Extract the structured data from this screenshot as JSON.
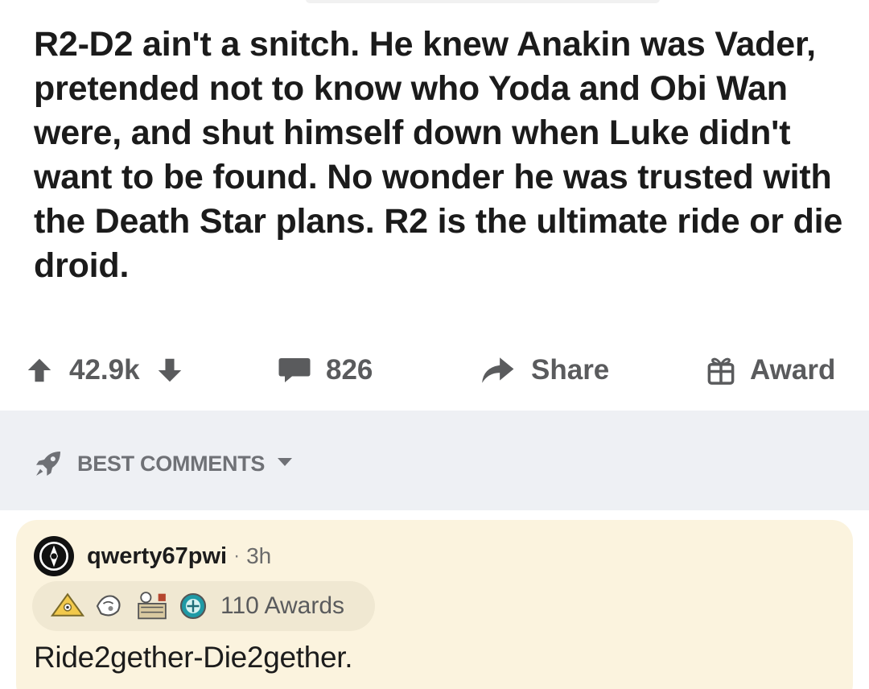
{
  "post": {
    "text": "R2-D2 ain't a snitch. He knew Anakin was Vader, pretended not to know who Yoda and Obi Wan were, and shut himself down when Luke didn't want to be found. No wonder he was trusted with the Death Star plans. R2 is the ultimate ride or die droid."
  },
  "actions": {
    "score": "42.9k",
    "comments": "826",
    "share_label": "Share",
    "award_label": "Award"
  },
  "sort": {
    "label": "BEST COMMENTS"
  },
  "comment": {
    "username": "qwerty67pwi",
    "separator": "·",
    "time": "3h",
    "awards_count": "110 Awards",
    "text": "Ride2gether-Die2gether."
  },
  "icons": [
    "upvote-icon",
    "downvote-icon",
    "comment-icon",
    "share-arrow-icon",
    "gift-icon",
    "rocket-icon",
    "caret-down-icon",
    "avatar-icon",
    "award-icons"
  ],
  "colors": {
    "text": "#1b1b1b",
    "muted": "#5a5b5d",
    "band": "#eef0f4",
    "card": "#fbf3de"
  }
}
